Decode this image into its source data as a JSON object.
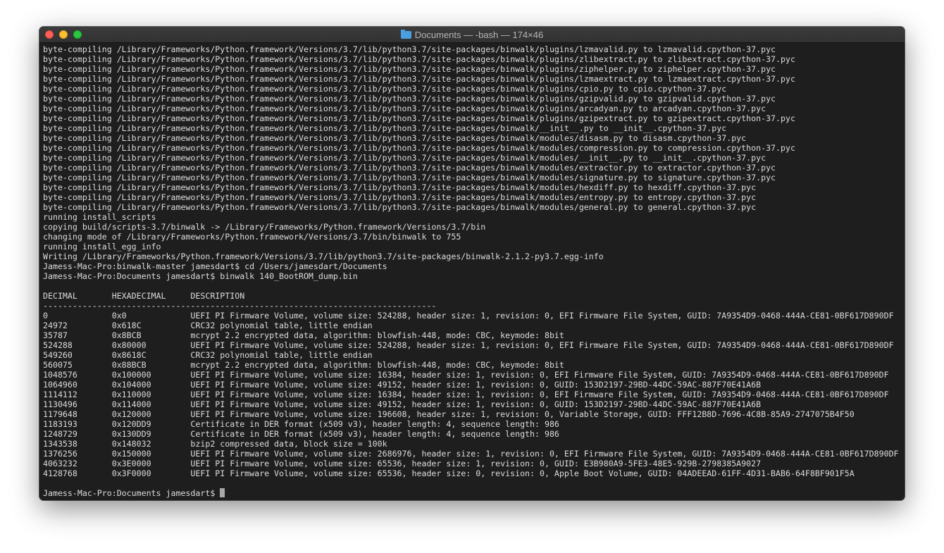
{
  "window": {
    "title": "Documents — -bash — 174×46"
  },
  "terminal": {
    "lines": [
      "byte-compiling /Library/Frameworks/Python.framework/Versions/3.7/lib/python3.7/site-packages/binwalk/plugins/lzmavalid.py to lzmavalid.cpython-37.pyc",
      "byte-compiling /Library/Frameworks/Python.framework/Versions/3.7/lib/python3.7/site-packages/binwalk/plugins/zlibextract.py to zlibextract.cpython-37.pyc",
      "byte-compiling /Library/Frameworks/Python.framework/Versions/3.7/lib/python3.7/site-packages/binwalk/plugins/ziphelper.py to ziphelper.cpython-37.pyc",
      "byte-compiling /Library/Frameworks/Python.framework/Versions/3.7/lib/python3.7/site-packages/binwalk/plugins/lzmaextract.py to lzmaextract.cpython-37.pyc",
      "byte-compiling /Library/Frameworks/Python.framework/Versions/3.7/lib/python3.7/site-packages/binwalk/plugins/cpio.py to cpio.cpython-37.pyc",
      "byte-compiling /Library/Frameworks/Python.framework/Versions/3.7/lib/python3.7/site-packages/binwalk/plugins/gzipvalid.py to gzipvalid.cpython-37.pyc",
      "byte-compiling /Library/Frameworks/Python.framework/Versions/3.7/lib/python3.7/site-packages/binwalk/plugins/arcadyan.py to arcadyan.cpython-37.pyc",
      "byte-compiling /Library/Frameworks/Python.framework/Versions/3.7/lib/python3.7/site-packages/binwalk/plugins/gzipextract.py to gzipextract.cpython-37.pyc",
      "byte-compiling /Library/Frameworks/Python.framework/Versions/3.7/lib/python3.7/site-packages/binwalk/__init__.py to __init__.cpython-37.pyc",
      "byte-compiling /Library/Frameworks/Python.framework/Versions/3.7/lib/python3.7/site-packages/binwalk/modules/disasm.py to disasm.cpython-37.pyc",
      "byte-compiling /Library/Frameworks/Python.framework/Versions/3.7/lib/python3.7/site-packages/binwalk/modules/compression.py to compression.cpython-37.pyc",
      "byte-compiling /Library/Frameworks/Python.framework/Versions/3.7/lib/python3.7/site-packages/binwalk/modules/__init__.py to __init__.cpython-37.pyc",
      "byte-compiling /Library/Frameworks/Python.framework/Versions/3.7/lib/python3.7/site-packages/binwalk/modules/extractor.py to extractor.cpython-37.pyc",
      "byte-compiling /Library/Frameworks/Python.framework/Versions/3.7/lib/python3.7/site-packages/binwalk/modules/signature.py to signature.cpython-37.pyc",
      "byte-compiling /Library/Frameworks/Python.framework/Versions/3.7/lib/python3.7/site-packages/binwalk/modules/hexdiff.py to hexdiff.cpython-37.pyc",
      "byte-compiling /Library/Frameworks/Python.framework/Versions/3.7/lib/python3.7/site-packages/binwalk/modules/entropy.py to entropy.cpython-37.pyc",
      "byte-compiling /Library/Frameworks/Python.framework/Versions/3.7/lib/python3.7/site-packages/binwalk/modules/general.py to general.cpython-37.pyc",
      "running install_scripts",
      "copying build/scripts-3.7/binwalk -> /Library/Frameworks/Python.framework/Versions/3.7/bin",
      "changing mode of /Library/Frameworks/Python.framework/Versions/3.7/bin/binwalk to 755",
      "running install_egg_info",
      "Writing /Library/Frameworks/Python.framework/Versions/3.7/lib/python3.7/site-packages/binwalk-2.1.2-py3.7.egg-info",
      "Jamess-Mac-Pro:binwalk-master jamesdart$ cd /Users/jamesdart/Documents",
      "Jamess-Mac-Pro:Documents jamesdart$ binwalk 140_BootROM_dump.bin",
      "",
      "DECIMAL       HEXADECIMAL     DESCRIPTION",
      "--------------------------------------------------------------------------------",
      "0             0x0             UEFI PI Firmware Volume, volume size: 524288, header size: 1, revision: 0, EFI Firmware File System, GUID: 7A9354D9-0468-444A-CE81-0BF617D890DF",
      "24972         0x618C          CRC32 polynomial table, little endian",
      "35787         0x8BCB          mcrypt 2.2 encrypted data, algorithm: blowfish-448, mode: CBC, keymode: 8bit",
      "524288        0x80000         UEFI PI Firmware Volume, volume size: 524288, header size: 1, revision: 0, EFI Firmware File System, GUID: 7A9354D9-0468-444A-CE81-0BF617D890DF",
      "549260        0x8618C         CRC32 polynomial table, little endian",
      "560075        0x88BCB         mcrypt 2.2 encrypted data, algorithm: blowfish-448, mode: CBC, keymode: 8bit",
      "1048576       0x100000        UEFI PI Firmware Volume, volume size: 16384, header size: 1, revision: 0, EFI Firmware File System, GUID: 7A9354D9-0468-444A-CE81-0BF617D890DF",
      "1064960       0x104000        UEFI PI Firmware Volume, volume size: 49152, header size: 1, revision: 0, GUID: 153D2197-29BD-44DC-59AC-887F70E41A6B",
      "1114112       0x110000        UEFI PI Firmware Volume, volume size: 16384, header size: 1, revision: 0, EFI Firmware File System, GUID: 7A9354D9-0468-444A-CE81-0BF617D890DF",
      "1130496       0x114000        UEFI PI Firmware Volume, volume size: 49152, header size: 1, revision: 0, GUID: 153D2197-29BD-44DC-59AC-887F70E41A6B",
      "1179648       0x120000        UEFI PI Firmware Volume, volume size: 196608, header size: 1, revision: 0, Variable Storage, GUID: FFF12B8D-7696-4C8B-85A9-2747075B4F50",
      "1183193       0x120DD9        Certificate in DER format (x509 v3), header length: 4, sequence length: 986",
      "1248729       0x130DD9        Certificate in DER format (x509 v3), header length: 4, sequence length: 986",
      "1343538       0x148032        bzip2 compressed data, block size = 100k",
      "1376256       0x150000        UEFI PI Firmware Volume, volume size: 2686976, header size: 1, revision: 0, EFI Firmware File System, GUID: 7A9354D9-0468-444A-CE81-0BF617D890DF",
      "4063232       0x3E0000        UEFI PI Firmware Volume, volume size: 65536, header size: 1, revision: 0, GUID: E3B980A9-5FE3-48E5-929B-2798385A9027",
      "4128768       0x3F0000        UEFI PI Firmware Volume, volume size: 65536, header size: 0, revision: 0, Apple Boot Volume, GUID: 04ADEEAD-61FF-4D31-BAB6-64F8BF901F5A",
      ""
    ],
    "prompt": "Jamess-Mac-Pro:Documents jamesdart$"
  },
  "colors": {
    "background": "#1e1e1e",
    "text": "#dcdcdc",
    "cursor": "#a8a8a8",
    "close": "#fe5f57",
    "minimize": "#febc2e",
    "maximize": "#28c840"
  },
  "icons": {
    "title": "folder-icon"
  }
}
